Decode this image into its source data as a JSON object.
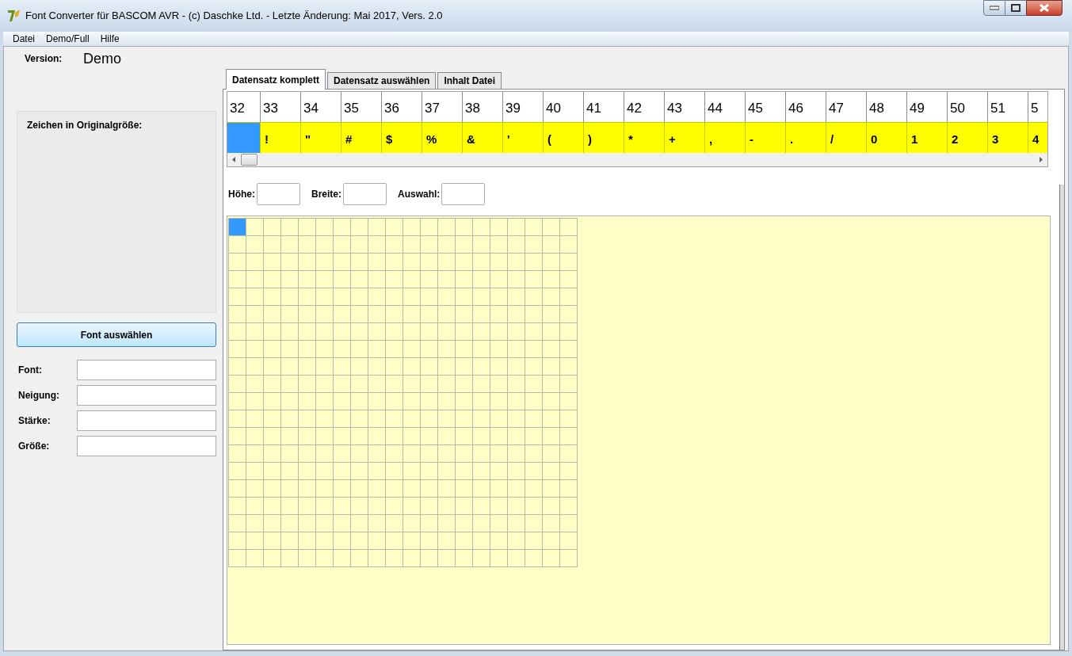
{
  "window": {
    "title": "Font Converter für BASCOM AVR - (c) Daschke Ltd. - Letzte Änderung: Mai 2017, Vers. 2.0"
  },
  "menu": [
    "Datei",
    "Demo/Full",
    "Hilfe"
  ],
  "sidebar": {
    "version_label": "Version:",
    "version_value": "Demo",
    "preview_label": "Zeichen in Originalgröße:",
    "font_button": "Font auswählen",
    "fields": [
      {
        "label": "Font:"
      },
      {
        "label": "Neigung:"
      },
      {
        "label": "Stärke:"
      },
      {
        "label": "Größe:"
      }
    ]
  },
  "tabs": [
    {
      "label": "Datensatz komplett",
      "selected": true
    },
    {
      "label": "Datensatz auswählen",
      "selected": false
    },
    {
      "label": "Inhalt Datei",
      "selected": false
    }
  ],
  "char_table": {
    "columns": [
      {
        "code": "32",
        "selected": true
      },
      {
        "code": "33",
        "char": "!",
        "selected": false
      },
      {
        "code": "34",
        "char": "\"",
        "selected": false
      },
      {
        "code": "35",
        "char": "#",
        "selected": false
      },
      {
        "code": "36",
        "char": "$",
        "selected": false
      },
      {
        "code": "37",
        "char": "%",
        "selected": false
      },
      {
        "code": "38",
        "char": "&",
        "selected": false
      },
      {
        "code": "39",
        "char": "'",
        "selected": false
      },
      {
        "code": "40",
        "char": "(",
        "selected": false
      },
      {
        "code": "41",
        "char": ")",
        "selected": false
      },
      {
        "code": "42",
        "char": "*",
        "selected": false
      },
      {
        "code": "43",
        "char": "+",
        "selected": false
      },
      {
        "code": "44",
        "char": ",",
        "selected": false
      },
      {
        "code": "45",
        "char": "-",
        "selected": false
      },
      {
        "code": "46",
        "char": ".",
        "selected": false
      },
      {
        "code": "47",
        "char": "/",
        "selected": false
      },
      {
        "code": "48",
        "char": "0",
        "selected": false
      },
      {
        "code": "49",
        "char": "1",
        "selected": false
      },
      {
        "code": "50",
        "char": "2",
        "selected": false
      },
      {
        "code": "51",
        "char": "3",
        "selected": false
      },
      {
        "code": "5",
        "char": "4",
        "selected": false
      }
    ]
  },
  "size_fields": [
    {
      "label": "Höhe:"
    },
    {
      "label": "Breite:"
    },
    {
      "label": "Auswahl:"
    }
  ],
  "grid": {
    "rows": [
      [
        true,
        false,
        false,
        false,
        false,
        false,
        false,
        false,
        false,
        false,
        false,
        false,
        false,
        false,
        false,
        false,
        false,
        false,
        false,
        false
      ],
      [
        false,
        false,
        false,
        false,
        false,
        false,
        false,
        false,
        false,
        false,
        false,
        false,
        false,
        false,
        false,
        false,
        false,
        false,
        false,
        false
      ],
      [
        false,
        false,
        false,
        false,
        false,
        false,
        false,
        false,
        false,
        false,
        false,
        false,
        false,
        false,
        false,
        false,
        false,
        false,
        false,
        false
      ],
      [
        false,
        false,
        false,
        false,
        false,
        false,
        false,
        false,
        false,
        false,
        false,
        false,
        false,
        false,
        false,
        false,
        false,
        false,
        false,
        false
      ],
      [
        false,
        false,
        false,
        false,
        false,
        false,
        false,
        false,
        false,
        false,
        false,
        false,
        false,
        false,
        false,
        false,
        false,
        false,
        false,
        false
      ],
      [
        false,
        false,
        false,
        false,
        false,
        false,
        false,
        false,
        false,
        false,
        false,
        false,
        false,
        false,
        false,
        false,
        false,
        false,
        false,
        false
      ],
      [
        false,
        false,
        false,
        false,
        false,
        false,
        false,
        false,
        false,
        false,
        false,
        false,
        false,
        false,
        false,
        false,
        false,
        false,
        false,
        false
      ],
      [
        false,
        false,
        false,
        false,
        false,
        false,
        false,
        false,
        false,
        false,
        false,
        false,
        false,
        false,
        false,
        false,
        false,
        false,
        false,
        false
      ],
      [
        false,
        false,
        false,
        false,
        false,
        false,
        false,
        false,
        false,
        false,
        false,
        false,
        false,
        false,
        false,
        false,
        false,
        false,
        false,
        false
      ],
      [
        false,
        false,
        false,
        false,
        false,
        false,
        false,
        false,
        false,
        false,
        false,
        false,
        false,
        false,
        false,
        false,
        false,
        false,
        false,
        false
      ],
      [
        false,
        false,
        false,
        false,
        false,
        false,
        false,
        false,
        false,
        false,
        false,
        false,
        false,
        false,
        false,
        false,
        false,
        false,
        false,
        false
      ],
      [
        false,
        false,
        false,
        false,
        false,
        false,
        false,
        false,
        false,
        false,
        false,
        false,
        false,
        false,
        false,
        false,
        false,
        false,
        false,
        false
      ],
      [
        false,
        false,
        false,
        false,
        false,
        false,
        false,
        false,
        false,
        false,
        false,
        false,
        false,
        false,
        false,
        false,
        false,
        false,
        false,
        false
      ],
      [
        false,
        false,
        false,
        false,
        false,
        false,
        false,
        false,
        false,
        false,
        false,
        false,
        false,
        false,
        false,
        false,
        false,
        false,
        false,
        false
      ],
      [
        false,
        false,
        false,
        false,
        false,
        false,
        false,
        false,
        false,
        false,
        false,
        false,
        false,
        false,
        false,
        false,
        false,
        false,
        false,
        false
      ],
      [
        false,
        false,
        false,
        false,
        false,
        false,
        false,
        false,
        false,
        false,
        false,
        false,
        false,
        false,
        false,
        false,
        false,
        false,
        false,
        false
      ],
      [
        false,
        false,
        false,
        false,
        false,
        false,
        false,
        false,
        false,
        false,
        false,
        false,
        false,
        false,
        false,
        false,
        false,
        false,
        false,
        false
      ],
      [
        false,
        false,
        false,
        false,
        false,
        false,
        false,
        false,
        false,
        false,
        false,
        false,
        false,
        false,
        false,
        false,
        false,
        false,
        false,
        false
      ],
      [
        false,
        false,
        false,
        false,
        false,
        false,
        false,
        false,
        false,
        false,
        false,
        false,
        false,
        false,
        false,
        false,
        false,
        false,
        false,
        false
      ],
      [
        false,
        false,
        false,
        false,
        false,
        false,
        false,
        false,
        false,
        false,
        false,
        false,
        false,
        false,
        false,
        false,
        false,
        false,
        false,
        false
      ]
    ]
  }
}
